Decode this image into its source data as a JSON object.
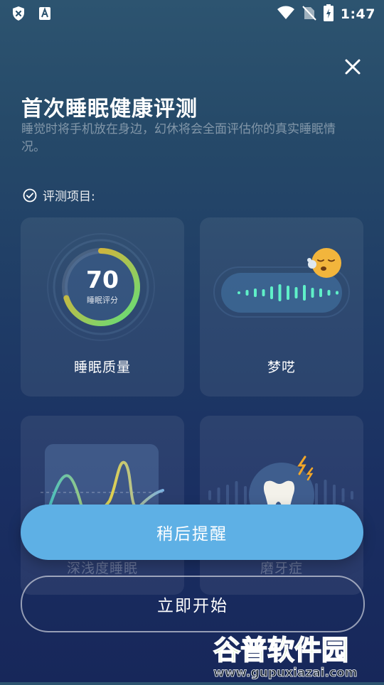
{
  "status_bar": {
    "time": "1:47",
    "icons": [
      "shield-x-icon",
      "font-a-icon",
      "wifi-icon",
      "no-sim-icon",
      "battery-charging-icon"
    ]
  },
  "dialog": {
    "title": "首次睡眠健康评测",
    "subtitle": "睡觉时将手机放在身边，幻休将会全面评估你的真实睡眠情况。",
    "section_label": "评测项目:"
  },
  "cards": [
    {
      "label": "睡眠质量",
      "score": "70",
      "score_caption": "睡眠评分",
      "score_fraction": 0.7,
      "icon": "sleep-score-ring"
    },
    {
      "label": "梦呓",
      "icon": "sleep-talk-wave"
    },
    {
      "label": "深浅度睡眠",
      "icon": "sleep-depth-curve"
    },
    {
      "label": "磨牙症",
      "icon": "tooth-icon"
    }
  ],
  "buttons": {
    "later": "稍后提醒",
    "start": "立即开始"
  },
  "watermark": {
    "brand": "谷普软件园",
    "url": "www.gupuxiazai.com"
  },
  "colors": {
    "accent": "#5eb0e5",
    "ring_start": "#5fe07a",
    "ring_end": "#f2a72a",
    "wave": "#5ff0c8"
  }
}
